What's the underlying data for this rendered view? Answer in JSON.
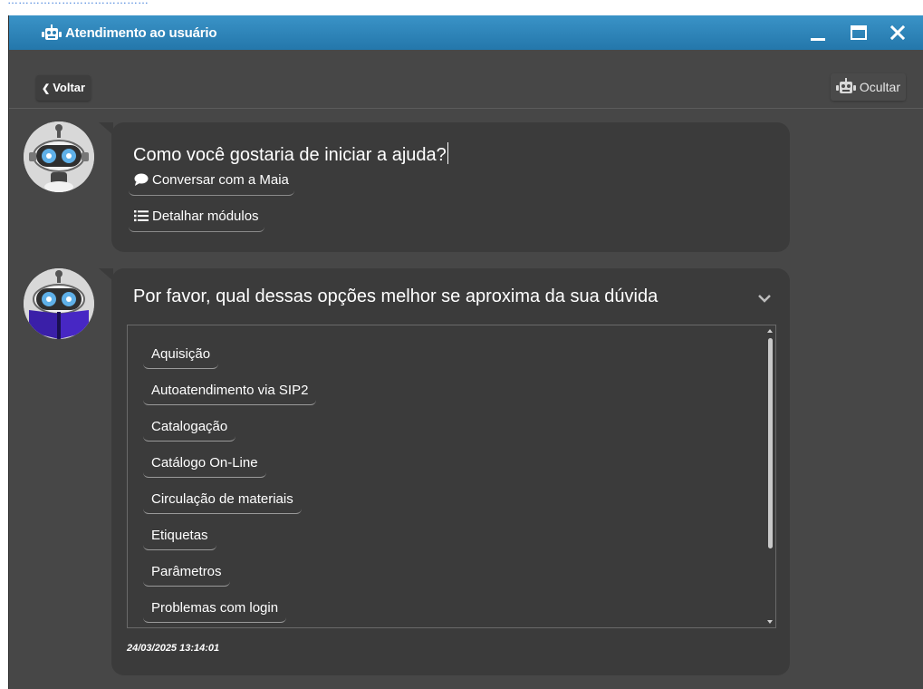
{
  "browser_fragment": "…………………………………",
  "window": {
    "title": "Atendimento ao usuário",
    "controls": [
      "minimize",
      "maximize",
      "close"
    ],
    "title_bar_color": "#2f86bc"
  },
  "toolbar": {
    "back_label": "Voltar",
    "hide_label": "Ocultar"
  },
  "messages": [
    {
      "question": "Como você gostaria de iniciar a ajuda?",
      "options": [
        {
          "label": "Conversar com a Maia",
          "icon": "chat-bubble-icon"
        },
        {
          "label": "Detalhar módulos",
          "icon": "list-icon"
        }
      ]
    },
    {
      "question": "Por favor, qual dessas opções melhor se aproxima da sua dúvida",
      "items": [
        "Aquisição",
        "Autoatendimento via SIP2",
        "Catalogação",
        "Catálogo On-Line",
        "Circulação de materiais",
        "Etiquetas",
        "Parâmetros",
        "Problemas com login"
      ],
      "timestamp": "24/03/2025 13:14:01"
    }
  ],
  "colors": {
    "background": "#474747",
    "bubble": "#3b3b3b",
    "accent": "#2f86bc"
  }
}
